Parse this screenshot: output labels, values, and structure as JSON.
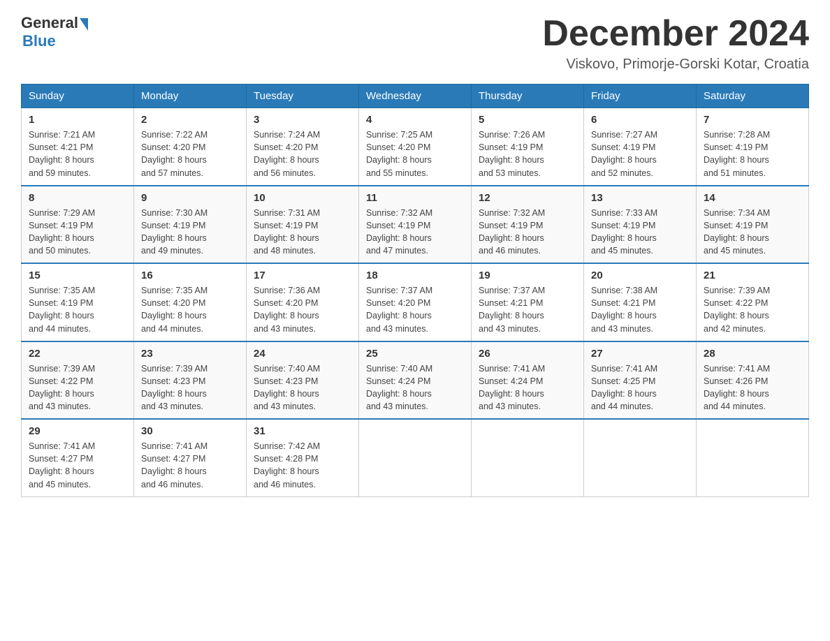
{
  "logo": {
    "general": "General",
    "blue": "Blue"
  },
  "title": {
    "month_year": "December 2024",
    "location": "Viskovo, Primorje-Gorski Kotar, Croatia"
  },
  "weekdays": [
    "Sunday",
    "Monday",
    "Tuesday",
    "Wednesday",
    "Thursday",
    "Friday",
    "Saturday"
  ],
  "weeks": [
    [
      {
        "day": "1",
        "sunrise": "7:21 AM",
        "sunset": "4:21 PM",
        "daylight": "8 hours and 59 minutes."
      },
      {
        "day": "2",
        "sunrise": "7:22 AM",
        "sunset": "4:20 PM",
        "daylight": "8 hours and 57 minutes."
      },
      {
        "day": "3",
        "sunrise": "7:24 AM",
        "sunset": "4:20 PM",
        "daylight": "8 hours and 56 minutes."
      },
      {
        "day": "4",
        "sunrise": "7:25 AM",
        "sunset": "4:20 PM",
        "daylight": "8 hours and 55 minutes."
      },
      {
        "day": "5",
        "sunrise": "7:26 AM",
        "sunset": "4:19 PM",
        "daylight": "8 hours and 53 minutes."
      },
      {
        "day": "6",
        "sunrise": "7:27 AM",
        "sunset": "4:19 PM",
        "daylight": "8 hours and 52 minutes."
      },
      {
        "day": "7",
        "sunrise": "7:28 AM",
        "sunset": "4:19 PM",
        "daylight": "8 hours and 51 minutes."
      }
    ],
    [
      {
        "day": "8",
        "sunrise": "7:29 AM",
        "sunset": "4:19 PM",
        "daylight": "8 hours and 50 minutes."
      },
      {
        "day": "9",
        "sunrise": "7:30 AM",
        "sunset": "4:19 PM",
        "daylight": "8 hours and 49 minutes."
      },
      {
        "day": "10",
        "sunrise": "7:31 AM",
        "sunset": "4:19 PM",
        "daylight": "8 hours and 48 minutes."
      },
      {
        "day": "11",
        "sunrise": "7:32 AM",
        "sunset": "4:19 PM",
        "daylight": "8 hours and 47 minutes."
      },
      {
        "day": "12",
        "sunrise": "7:32 AM",
        "sunset": "4:19 PM",
        "daylight": "8 hours and 46 minutes."
      },
      {
        "day": "13",
        "sunrise": "7:33 AM",
        "sunset": "4:19 PM",
        "daylight": "8 hours and 45 minutes."
      },
      {
        "day": "14",
        "sunrise": "7:34 AM",
        "sunset": "4:19 PM",
        "daylight": "8 hours and 45 minutes."
      }
    ],
    [
      {
        "day": "15",
        "sunrise": "7:35 AM",
        "sunset": "4:19 PM",
        "daylight": "8 hours and 44 minutes."
      },
      {
        "day": "16",
        "sunrise": "7:35 AM",
        "sunset": "4:20 PM",
        "daylight": "8 hours and 44 minutes."
      },
      {
        "day": "17",
        "sunrise": "7:36 AM",
        "sunset": "4:20 PM",
        "daylight": "8 hours and 43 minutes."
      },
      {
        "day": "18",
        "sunrise": "7:37 AM",
        "sunset": "4:20 PM",
        "daylight": "8 hours and 43 minutes."
      },
      {
        "day": "19",
        "sunrise": "7:37 AM",
        "sunset": "4:21 PM",
        "daylight": "8 hours and 43 minutes."
      },
      {
        "day": "20",
        "sunrise": "7:38 AM",
        "sunset": "4:21 PM",
        "daylight": "8 hours and 43 minutes."
      },
      {
        "day": "21",
        "sunrise": "7:39 AM",
        "sunset": "4:22 PM",
        "daylight": "8 hours and 42 minutes."
      }
    ],
    [
      {
        "day": "22",
        "sunrise": "7:39 AM",
        "sunset": "4:22 PM",
        "daylight": "8 hours and 43 minutes."
      },
      {
        "day": "23",
        "sunrise": "7:39 AM",
        "sunset": "4:23 PM",
        "daylight": "8 hours and 43 minutes."
      },
      {
        "day": "24",
        "sunrise": "7:40 AM",
        "sunset": "4:23 PM",
        "daylight": "8 hours and 43 minutes."
      },
      {
        "day": "25",
        "sunrise": "7:40 AM",
        "sunset": "4:24 PM",
        "daylight": "8 hours and 43 minutes."
      },
      {
        "day": "26",
        "sunrise": "7:41 AM",
        "sunset": "4:24 PM",
        "daylight": "8 hours and 43 minutes."
      },
      {
        "day": "27",
        "sunrise": "7:41 AM",
        "sunset": "4:25 PM",
        "daylight": "8 hours and 44 minutes."
      },
      {
        "day": "28",
        "sunrise": "7:41 AM",
        "sunset": "4:26 PM",
        "daylight": "8 hours and 44 minutes."
      }
    ],
    [
      {
        "day": "29",
        "sunrise": "7:41 AM",
        "sunset": "4:27 PM",
        "daylight": "8 hours and 45 minutes."
      },
      {
        "day": "30",
        "sunrise": "7:41 AM",
        "sunset": "4:27 PM",
        "daylight": "8 hours and 46 minutes."
      },
      {
        "day": "31",
        "sunrise": "7:42 AM",
        "sunset": "4:28 PM",
        "daylight": "8 hours and 46 minutes."
      },
      null,
      null,
      null,
      null
    ]
  ],
  "labels": {
    "sunrise": "Sunrise:",
    "sunset": "Sunset:",
    "daylight": "Daylight:"
  }
}
